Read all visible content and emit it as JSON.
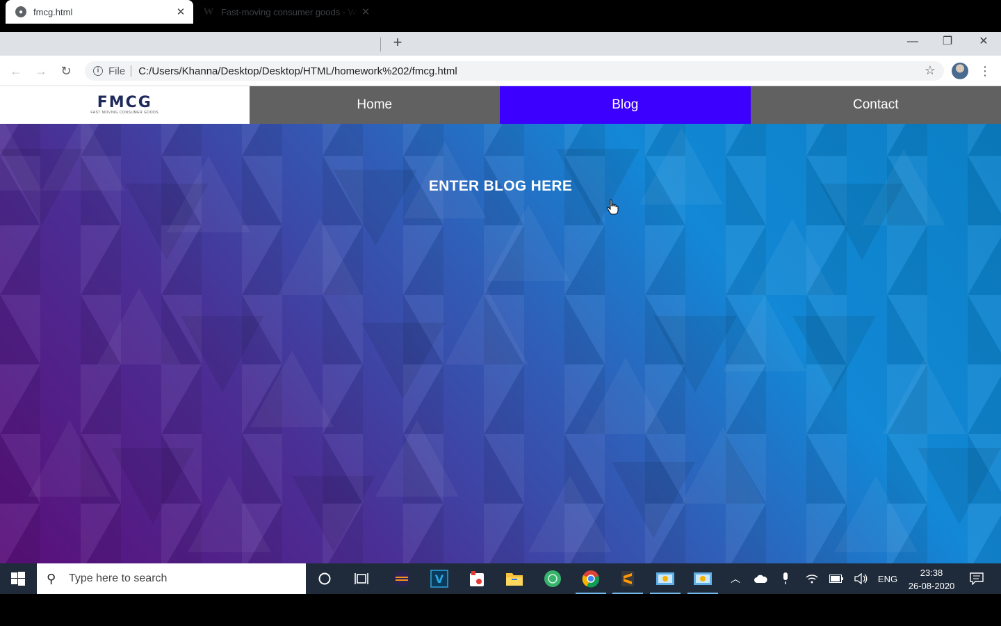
{
  "browser": {
    "tabs": [
      {
        "title": "fmcg.html",
        "favicon": "globe-icon",
        "active": true
      },
      {
        "title": "Fast-moving consumer goods - Wikipedia",
        "favicon": "wikipedia-icon",
        "active": false
      }
    ],
    "new_tab": "+",
    "window_controls": {
      "minimize": "—",
      "restore": "❐",
      "close": "✕"
    },
    "scheme_label": "File",
    "url": "C:/Users/Khanna/Desktop/Desktop/HTML/homework%202/fmcg.html"
  },
  "site": {
    "logo": {
      "title": "FMCG",
      "tagline": "FAST MOVING CONSUMER GOODS"
    },
    "nav": [
      {
        "label": "Home",
        "active": false
      },
      {
        "label": "Blog",
        "active": true
      },
      {
        "label": "Contact",
        "active": false
      }
    ],
    "heading": "ENTER BLOG HERE",
    "colors": {
      "nav_bg": "#616161",
      "nav_active": "#3c00ff"
    }
  },
  "taskbar": {
    "search_placeholder": "Type here to search",
    "language": "ENG",
    "time": "23:38",
    "date": "26-08-2020"
  }
}
